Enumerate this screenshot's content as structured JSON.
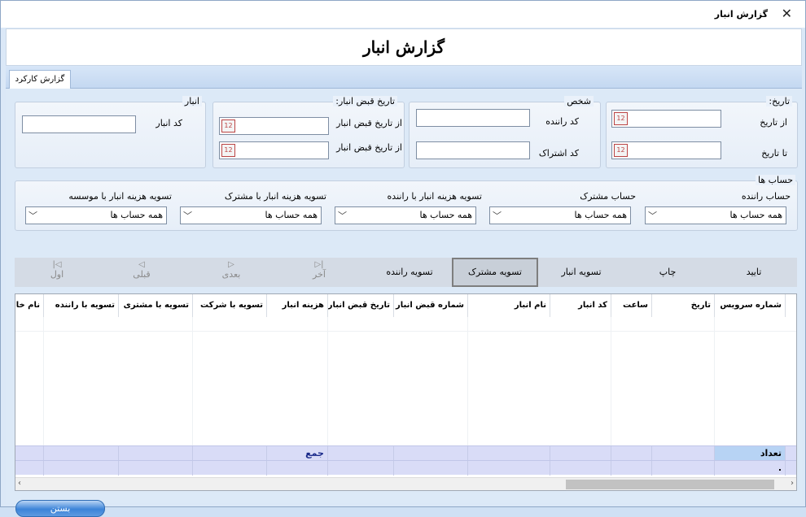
{
  "window": {
    "title": "گزارش انبار",
    "close_glyph": "✕"
  },
  "header": {
    "title": "گزارش انبار"
  },
  "tabs": [
    {
      "label": "گزارش کارکرد"
    }
  ],
  "date_group": {
    "legend": "تاریخ:",
    "from_label": "از تاریخ",
    "to_label": "تا تاریخ",
    "from_value": "",
    "to_value": ""
  },
  "person_group": {
    "legend": "شخص",
    "driver_code_label": "کد راننده",
    "subscription_code_label": "کد اشتراک",
    "driver_code_value": "",
    "subscription_code_value": ""
  },
  "receipt_group": {
    "legend": "تاریخ قبض انبار:",
    "from1_label": "از تاریخ قبض انبار",
    "from2_label": "از تاریخ قبض انبار",
    "from1_value": "",
    "from2_value": ""
  },
  "warehouse_group": {
    "legend": "انبار",
    "code_label": "کد انبار",
    "code_value": ""
  },
  "accounts": {
    "legend": "حساب ها",
    "fields": [
      {
        "label": "حساب راننده",
        "value": "همه حساب ها"
      },
      {
        "label": "حساب مشترک",
        "value": "همه حساب ها"
      },
      {
        "label": "تسویه هزینه انبار با راننده",
        "value": "همه حساب ها"
      },
      {
        "label": "تسویه هزینه انبار با مشترک",
        "value": "همه حساب ها"
      },
      {
        "label": "تسویه هزینه انبار با موسسه",
        "value": "همه حساب ها"
      }
    ]
  },
  "toolbar": {
    "nav": {
      "first": "اول",
      "prev": "قبلی",
      "next": "بعدی",
      "last": "آخر"
    },
    "buttons": {
      "driver_settle": "تسویه راننده",
      "customer_settle": "تسویه مشترک",
      "warehouse_settle": "تسویه انبار",
      "print": "چاپ",
      "confirm": "تایید"
    }
  },
  "grid": {
    "columns": [
      "شماره سرویس",
      "تاریخ",
      "ساعت",
      "کد انبار",
      "نام انبار",
      "شماره قبض انبار",
      "تاریخ قبض انبار",
      "هزینه انبار",
      "تسویه با شرکت",
      "تسویه با مشتری",
      "تسویه با راننده",
      "نام خانوا"
    ],
    "footer": {
      "count_label": "تعداد",
      "sum_label": "جمع",
      "count_value": "."
    }
  },
  "close_button": {
    "label": "بستن"
  },
  "colors": {
    "accent": "#3c84d8",
    "footer_row": "#d9dcf7",
    "count_cell": "#b7d3f4"
  }
}
